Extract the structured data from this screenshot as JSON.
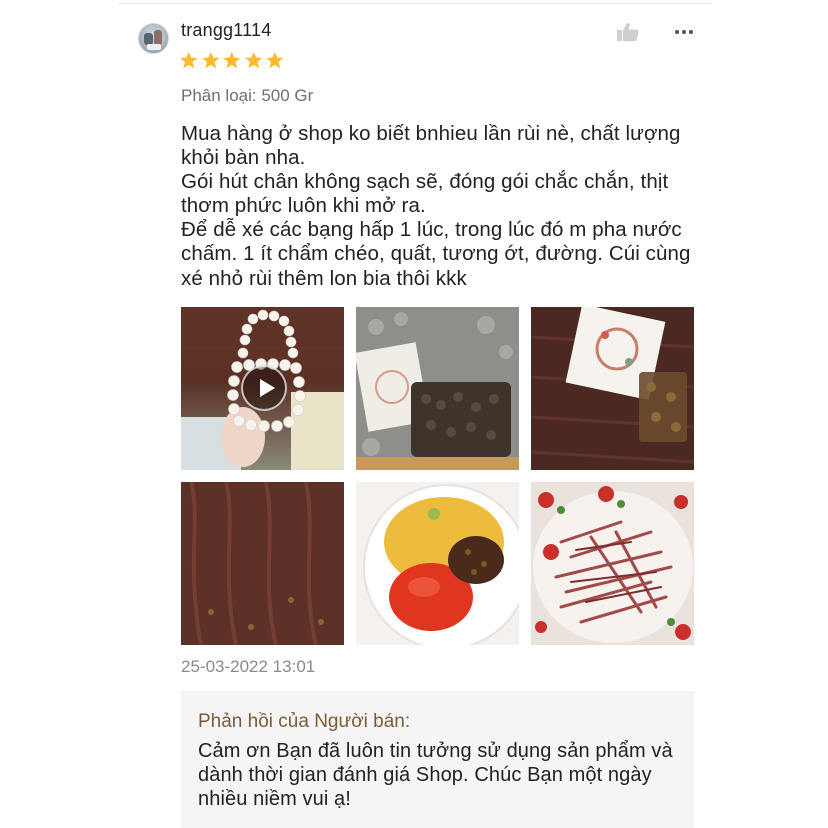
{
  "review": {
    "username": "trangg1114",
    "rating": 5,
    "rating_max": 5,
    "variation": "Phân loại: 500 Gr",
    "comment": "Mua hàng ở shop ko biết bnhieu lần rùi nè, chất lượng khỏi bàn nha.\nGói hút chân không sạch sẽ, đóng gói chắc chắn, thịt thơm phức luôn khi mở ra.\nĐể dễ xé các bạng hấp 1 lúc, trong lúc đó m pha nước chấm. 1 ít chẩm chéo, quất, tương ớt, đường. Cúi cùng xé nhỏ rùi thêm lon bia thôi kkk",
    "timestamp": "25-03-2022 13:01",
    "media": [
      {
        "kind": "video",
        "name": "pearl-bag-video"
      },
      {
        "kind": "image",
        "name": "packed-beef-photo"
      },
      {
        "kind": "image",
        "name": "thank-you-card-photo"
      },
      {
        "kind": "image",
        "name": "dried-beef-closeup-photo"
      },
      {
        "kind": "image",
        "name": "dipping-sauce-photo"
      },
      {
        "kind": "image",
        "name": "shredded-beef-plate-photo"
      }
    ],
    "icons": {
      "like": "thumbs-up-icon",
      "more": "more-options-icon",
      "star": "star-icon",
      "play": "play-icon"
    },
    "colors": {
      "star": "#fcbb2f",
      "reply_title": "#7a5b3a",
      "reply_bg": "#f5f5f5"
    }
  },
  "seller_reply": {
    "title": "Phản hồi của Người bán:",
    "text": "Cảm ơn Bạn đã luôn tin tưởng sử dụng sản phẩm và dành thời gian đánh giá Shop. Chúc Bạn một ngày nhiều niềm vui ạ!"
  }
}
